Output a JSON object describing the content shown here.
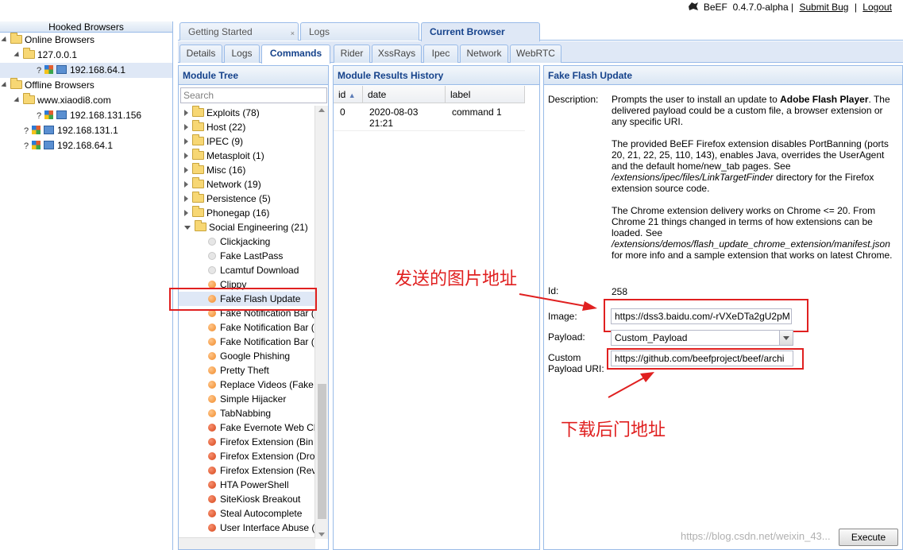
{
  "topbar": {
    "app_name": "BeEF",
    "version": "0.4.7.0-alpha",
    "separator": "|",
    "submit_bug": "Submit Bug",
    "logout": "Logout"
  },
  "hooked": {
    "title": "Hooked Browsers",
    "online_label": "Online Browsers",
    "online_host": "127.0.0.1",
    "online_ip": "192.168.64.1",
    "offline_label": "Offline Browsers",
    "offline_domain": "www.xiaodi8.com",
    "offline_ip1": "192.168.131.156",
    "offline_ip2": "192.168.131.1",
    "offline_ip3": "192.168.64.1",
    "unknown_mark": "?"
  },
  "tabs_main": [
    "Getting Started",
    "Logs",
    "Current Browser"
  ],
  "tab_close": "×",
  "tabs_sub": [
    "Details",
    "Logs",
    "Commands",
    "Rider",
    "XssRays",
    "Ipec",
    "Network",
    "WebRTC"
  ],
  "module_tree": {
    "title": "Module Tree",
    "search_placeholder": "Search",
    "categories": [
      "Exploits (78)",
      "Host (22)",
      "IPEC (9)",
      "Metasploit (1)",
      "Misc (16)",
      "Network (19)",
      "Persistence (5)",
      "Phonegap (16)",
      "Social Engineering (21)"
    ],
    "modules": [
      {
        "label": "Clickjacking",
        "status": "white"
      },
      {
        "label": "Fake LastPass",
        "status": "white"
      },
      {
        "label": "Lcamtuf Download",
        "status": "white"
      },
      {
        "label": "Clippy",
        "status": "orange"
      },
      {
        "label": "Fake Flash Update",
        "status": "orange"
      },
      {
        "label": "Fake Notification Bar (",
        "status": "orange"
      },
      {
        "label": "Fake Notification Bar (",
        "status": "orange"
      },
      {
        "label": "Fake Notification Bar (",
        "status": "orange"
      },
      {
        "label": "Google Phishing",
        "status": "orange"
      },
      {
        "label": "Pretty Theft",
        "status": "orange"
      },
      {
        "label": "Replace Videos (Fake",
        "status": "orange"
      },
      {
        "label": "Simple Hijacker",
        "status": "orange"
      },
      {
        "label": "TabNabbing",
        "status": "orange"
      },
      {
        "label": "Fake Evernote Web Cl",
        "status": "red"
      },
      {
        "label": "Firefox Extension (Bin",
        "status": "red"
      },
      {
        "label": "Firefox Extension (Dro",
        "status": "red"
      },
      {
        "label": "Firefox Extension (Rev",
        "status": "red"
      },
      {
        "label": "HTA PowerShell",
        "status": "red"
      },
      {
        "label": "SiteKiosk Breakout",
        "status": "red"
      },
      {
        "label": "Steal Autocomplete",
        "status": "red"
      },
      {
        "label": "User Interface Abuse (",
        "status": "red"
      }
    ]
  },
  "results": {
    "title": "Module Results History",
    "columns": [
      "id",
      "date",
      "label"
    ],
    "sort_indicator": "▲",
    "rows": [
      {
        "id": "0",
        "date": "2020-08-03 21:21",
        "label": "command 1"
      }
    ]
  },
  "module": {
    "title": "Fake Flash Update",
    "description_label": "Description:",
    "desc_p1_pre": "Prompts the user to install an update to ",
    "desc_p1_bold": "Adobe Flash Player",
    "desc_p1_post": ". The delivered payload could be a custom file, a browser extension or any specific URI.",
    "desc_p2_pre": "The provided BeEF Firefox extension disables PortBanning (ports 20, 21, 22, 25, 110, 143), enables Java, overrides the UserAgent and the default home/new_tab pages. See ",
    "desc_p2_em": "/extensions/ipec/files/LinkTargetFinder",
    "desc_p2_post": " directory for the Firefox extension source code.",
    "desc_p3_pre": "The Chrome extension delivery works on Chrome <= 20. From Chrome 21 things changed in terms of how extensions can be loaded. See ",
    "desc_p3_em": "/extensions/demos/flash_update_chrome_extension/manifest.json",
    "desc_p3_post": " for more info and a sample extension that works on latest Chrome.",
    "id_label": "Id:",
    "id_value": "258",
    "image_label": "Image:",
    "image_value": "https://dss3.baidu.com/-rVXeDTa2gU2pM",
    "payload_label": "Payload:",
    "payload_value": "Custom_Payload",
    "uri_label": "Custom Payload URI:",
    "uri_value": "https://github.com/beefproject/beef/archi",
    "execute": "Execute"
  },
  "annotations": {
    "image_note": "发送的图片地址",
    "backdoor_note": "下载后门地址"
  },
  "watermark": "https://blog.csdn.net/weixin_43..."
}
